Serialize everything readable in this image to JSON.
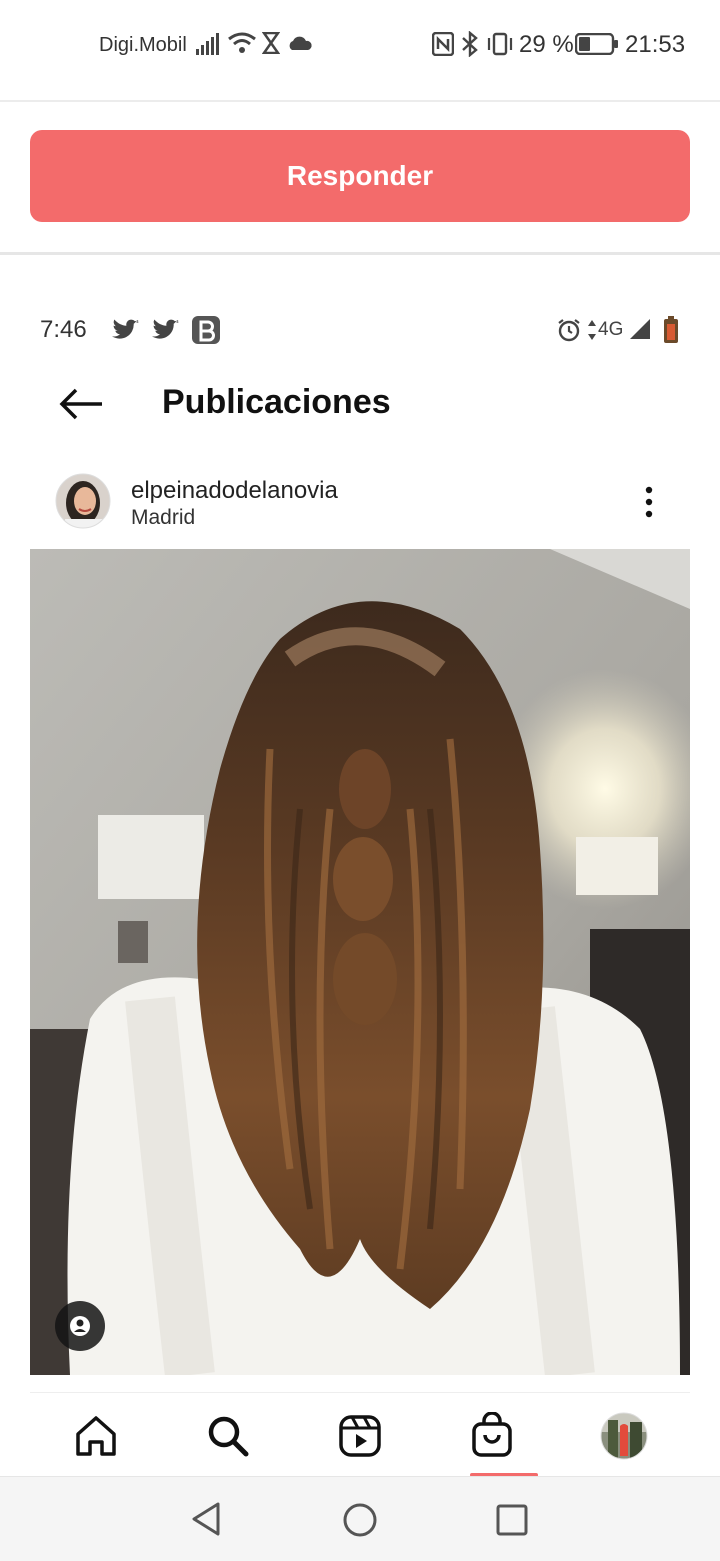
{
  "status_bar": {
    "carrier": "Digi.Mobil",
    "battery": "29 %",
    "time": "21:53"
  },
  "respond": {
    "label": "Responder"
  },
  "inner": {
    "status_time": "7:46",
    "status_network": "4G",
    "header": {
      "title": "Publicaciones"
    },
    "post": {
      "username": "elpeinadodelanovia",
      "location": "Madrid"
    }
  },
  "bottom_nav": [
    "home-icon",
    "search-icon",
    "reels-icon",
    "shop-icon",
    "profile-avatar"
  ],
  "android_nav": [
    "back-icon",
    "home-circle-icon",
    "recents-icon"
  ],
  "colors": {
    "accent": "#f36b6b"
  }
}
